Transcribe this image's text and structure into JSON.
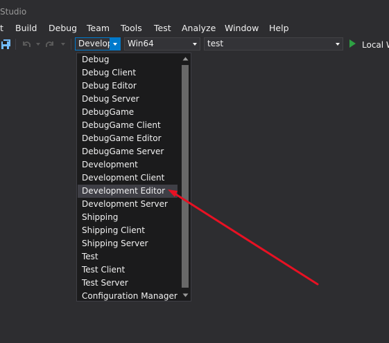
{
  "window": {
    "title_fragment": "Studio"
  },
  "menu": {
    "items": [
      {
        "id": "file",
        "label": "t"
      },
      {
        "id": "build",
        "label": "Build"
      },
      {
        "id": "debug",
        "label": "Debug"
      },
      {
        "id": "team",
        "label": "Team"
      },
      {
        "id": "tools",
        "label": "Tools"
      },
      {
        "id": "test",
        "label": "Test"
      },
      {
        "id": "analyze",
        "label": "Analyze"
      },
      {
        "id": "window",
        "label": "Window"
      },
      {
        "id": "help",
        "label": "Help"
      }
    ]
  },
  "toolbar": {
    "icons": [
      "save-all-icon",
      "undo-icon",
      "undo-dropdown-icon",
      "redo-icon",
      "redo-dropdown-icon"
    ],
    "configuration_combo": {
      "value": "Developm"
    },
    "platform_combo": {
      "value": "Win64"
    },
    "project_combo": {
      "value": "test"
    },
    "run_button": {
      "label": "Local W",
      "icon": "play-icon"
    }
  },
  "configuration_dropdown": {
    "selected": "Development Editor",
    "items": [
      "Debug",
      "Debug Client",
      "Debug Editor",
      "Debug Server",
      "DebugGame",
      "DebugGame Client",
      "DebugGame Editor",
      "DebugGame Server",
      "Development",
      "Development Client",
      "Development Editor",
      "Development Server",
      "Shipping",
      "Shipping Client",
      "Shipping Server",
      "Test",
      "Test Client",
      "Test Server",
      "Configuration Manager..."
    ]
  },
  "annotation": {
    "kind": "arrow",
    "color": "#e81123",
    "points_to": "Development Editor"
  },
  "colors": {
    "background": "#2d2d30",
    "accent": "#007acc",
    "dropdown_bg": "#1b1b1c",
    "hover": "#3f3f46",
    "play_green": "#2ea043"
  }
}
